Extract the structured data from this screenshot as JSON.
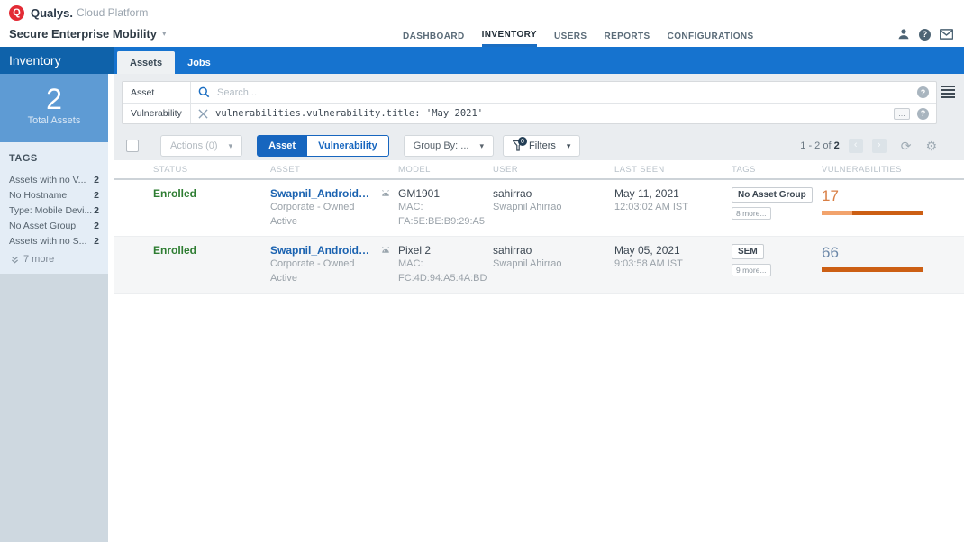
{
  "brand": {
    "logo_letter": "Q",
    "name": "Qualys.",
    "suffix": "Cloud Platform"
  },
  "menubar": {
    "module": "Secure Enterprise Mobility",
    "nav": [
      {
        "label": "DASHBOARD",
        "active": false
      },
      {
        "label": "INVENTORY",
        "active": true
      },
      {
        "label": "USERS",
        "active": false
      },
      {
        "label": "REPORTS",
        "active": false
      },
      {
        "label": "CONFIGURATIONS",
        "active": false
      }
    ]
  },
  "sidebar": {
    "title": "Inventory",
    "total_count": "2",
    "total_label": "Total Assets",
    "tags_header": "TAGS",
    "tags": [
      {
        "label": "Assets with no V...",
        "count": "2"
      },
      {
        "label": "No Hostname",
        "count": "2"
      },
      {
        "label": "Type: Mobile Devi...",
        "count": "2"
      },
      {
        "label": "No Asset Group",
        "count": "2"
      },
      {
        "label": "Assets with no S...",
        "count": "2"
      }
    ],
    "more_label": "7 more"
  },
  "tabs": {
    "assets": "Assets",
    "jobs": "Jobs"
  },
  "search": {
    "asset_label": "Asset",
    "asset_placeholder": "Search...",
    "vuln_label": "Vulnerability",
    "vuln_query": "vulnerabilities.vulnerability.title: 'May 2021'",
    "expand_label": "..."
  },
  "toolbar": {
    "actions": "Actions (0)",
    "toggle_asset": "Asset",
    "toggle_vuln": "Vulnerability",
    "group_by": "Group By: ...",
    "filters": "Filters",
    "filters_badge": "0",
    "pagination_range": "1 - 2 of",
    "pagination_total": "2"
  },
  "table": {
    "columns": [
      "STATUS",
      "ASSET",
      "MODEL",
      "USER",
      "LAST SEEN",
      "TAGS",
      "VULNERABILITIES"
    ],
    "rows": [
      {
        "status": "Enrolled",
        "asset": "Swapnil_Android_OnePlus",
        "ownership": "Corporate - Owned",
        "activation": "Active",
        "model": "GM1901",
        "mac": "MAC: FA:5E:BE:B9:29:A5",
        "user": "sahirrao",
        "user_full": "Swapnil Ahirrao",
        "last_seen_date": "May 11, 2021",
        "last_seen_time": "12:03:02 AM IST",
        "tag": "No Asset Group",
        "tag_more": "8 more...",
        "vulnerabilities": {
          "count": "17",
          "count_color": "#d97f45",
          "segments": [
            {
              "percent": 30,
              "color": "#f2a36c"
            },
            {
              "percent": 70,
              "color": "#cc5f14"
            }
          ]
        }
      },
      {
        "status": "Enrolled",
        "asset": "Swapnil_Android_Google...",
        "ownership": "Corporate - Owned",
        "activation": "Active",
        "model": "Pixel 2",
        "mac": "MAC: FC:4D:94:A5:4A:BD",
        "user": "sahirrao",
        "user_full": "Swapnil Ahirrao",
        "last_seen_date": "May 05, 2021",
        "last_seen_time": "9:03:58 AM IST",
        "tag": "SEM",
        "tag_more": "9 more...",
        "vulnerabilities": {
          "count": "66",
          "count_color": "#6b87a8",
          "segments": [
            {
              "percent": 100,
              "color": "#cc5f14"
            }
          ]
        }
      }
    ]
  }
}
